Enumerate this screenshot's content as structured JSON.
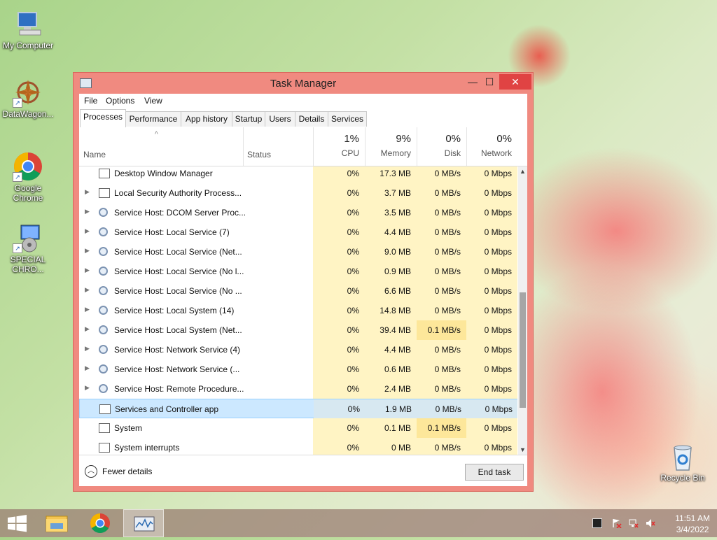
{
  "desktop": {
    "icons": [
      {
        "label": "My Computer"
      },
      {
        "label": "DataWagon..."
      },
      {
        "label": "Google Chrome"
      },
      {
        "label": "SPECIAL CHRO..."
      },
      {
        "label": "Recycle Bin"
      }
    ]
  },
  "window": {
    "title": "Task Manager",
    "controls": {
      "minimize": "—",
      "maximize": "☐",
      "close": "✕"
    }
  },
  "menu": [
    "File",
    "Options",
    "View"
  ],
  "tabs": [
    "Processes",
    "Performance",
    "App history",
    "Startup",
    "Users",
    "Details",
    "Services"
  ],
  "columns": {
    "name": "Name",
    "status": "Status",
    "cpu": {
      "pct": "1%",
      "label": "CPU"
    },
    "memory": {
      "pct": "9%",
      "label": "Memory"
    },
    "disk": {
      "pct": "0%",
      "label": "Disk"
    },
    "network": {
      "pct": "0%",
      "label": "Network"
    }
  },
  "processes": [
    {
      "name": "Desktop Window Manager",
      "cpu": "0%",
      "memory": "17.3 MB",
      "disk": "0 MB/s",
      "network": "0 Mbps"
    },
    {
      "name": "Local Security Authority Process...",
      "cpu": "0%",
      "memory": "3.7 MB",
      "disk": "0 MB/s",
      "network": "0 Mbps"
    },
    {
      "name": "Service Host: DCOM Server Proc...",
      "cpu": "0%",
      "memory": "3.5 MB",
      "disk": "0 MB/s",
      "network": "0 Mbps"
    },
    {
      "name": "Service Host: Local Service (7)",
      "cpu": "0%",
      "memory": "4.4 MB",
      "disk": "0 MB/s",
      "network": "0 Mbps"
    },
    {
      "name": "Service Host: Local Service (Net...",
      "cpu": "0%",
      "memory": "9.0 MB",
      "disk": "0 MB/s",
      "network": "0 Mbps"
    },
    {
      "name": "Service Host: Local Service (No l...",
      "cpu": "0%",
      "memory": "0.9 MB",
      "disk": "0 MB/s",
      "network": "0 Mbps"
    },
    {
      "name": "Service Host: Local Service (No ...",
      "cpu": "0%",
      "memory": "6.6 MB",
      "disk": "0 MB/s",
      "network": "0 Mbps"
    },
    {
      "name": "Service Host: Local System (14)",
      "cpu": "0%",
      "memory": "14.8 MB",
      "disk": "0 MB/s",
      "network": "0 Mbps"
    },
    {
      "name": "Service Host: Local System (Net...",
      "cpu": "0%",
      "memory": "39.4 MB",
      "disk": "0.1 MB/s",
      "network": "0 Mbps"
    },
    {
      "name": "Service Host: Network Service (4)",
      "cpu": "0%",
      "memory": "4.4 MB",
      "disk": "0 MB/s",
      "network": "0 Mbps"
    },
    {
      "name": "Service Host: Network Service (...",
      "cpu": "0%",
      "memory": "0.6 MB",
      "disk": "0 MB/s",
      "network": "0 Mbps"
    },
    {
      "name": "Service Host: Remote Procedure...",
      "cpu": "0%",
      "memory": "2.4 MB",
      "disk": "0 MB/s",
      "network": "0 Mbps"
    },
    {
      "name": "Services and Controller app",
      "cpu": "0%",
      "memory": "1.9 MB",
      "disk": "0 MB/s",
      "network": "0 Mbps"
    },
    {
      "name": "System",
      "cpu": "0%",
      "memory": "0.1 MB",
      "disk": "0.1 MB/s",
      "network": "0 Mbps"
    },
    {
      "name": "System interrupts",
      "cpu": "0%",
      "memory": "0 MB",
      "disk": "0 MB/s",
      "network": "0 Mbps"
    }
  ],
  "footer": {
    "fewer_details": "Fewer details",
    "end_task": "End task"
  },
  "taskbar": {
    "time": "11:51 AM",
    "date": "3/4/2022"
  },
  "colors": {
    "window_frame": "#f08a80",
    "close_button": "#e04343",
    "cell_highlight": "#fff4c4",
    "selected_row": "#cce8ff"
  }
}
